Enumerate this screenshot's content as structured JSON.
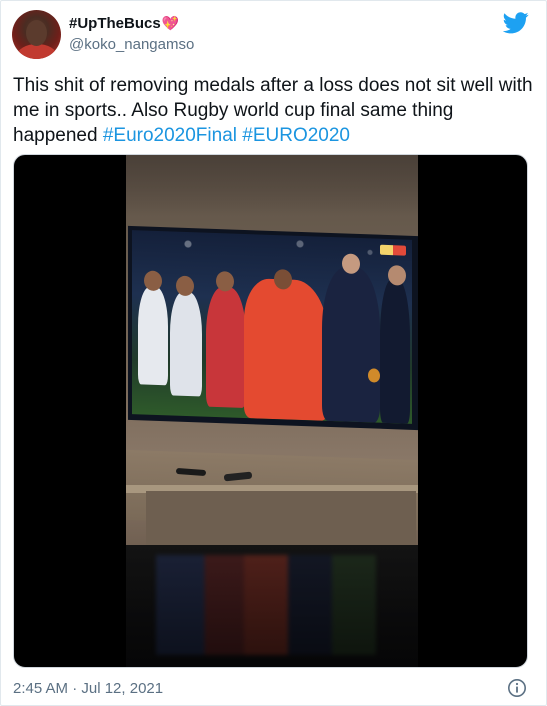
{
  "author": {
    "display_name": "#UpTheBucs",
    "emoji": "💖",
    "username": "@koko_nangamso"
  },
  "tweet": {
    "text_before": "This shit of removing medals after a loss does not sit well with me in sports.. Also Rugby world cup final same thing happened ",
    "hashtag_1": "#Euro2020Final",
    "text_between": " ",
    "hashtag_2": "#EURO2020"
  },
  "media": {
    "type": "video",
    "icon": "video-still"
  },
  "footer": {
    "timestamp": "2:45 AM · Jul 12, 2021"
  },
  "icons": {
    "brand": "twitter-bird-icon",
    "info": "info-icon"
  },
  "colors": {
    "hashtag": "#1b95e0",
    "secondary_text": "#5b7083",
    "twitter_blue": "#1da1f2"
  }
}
